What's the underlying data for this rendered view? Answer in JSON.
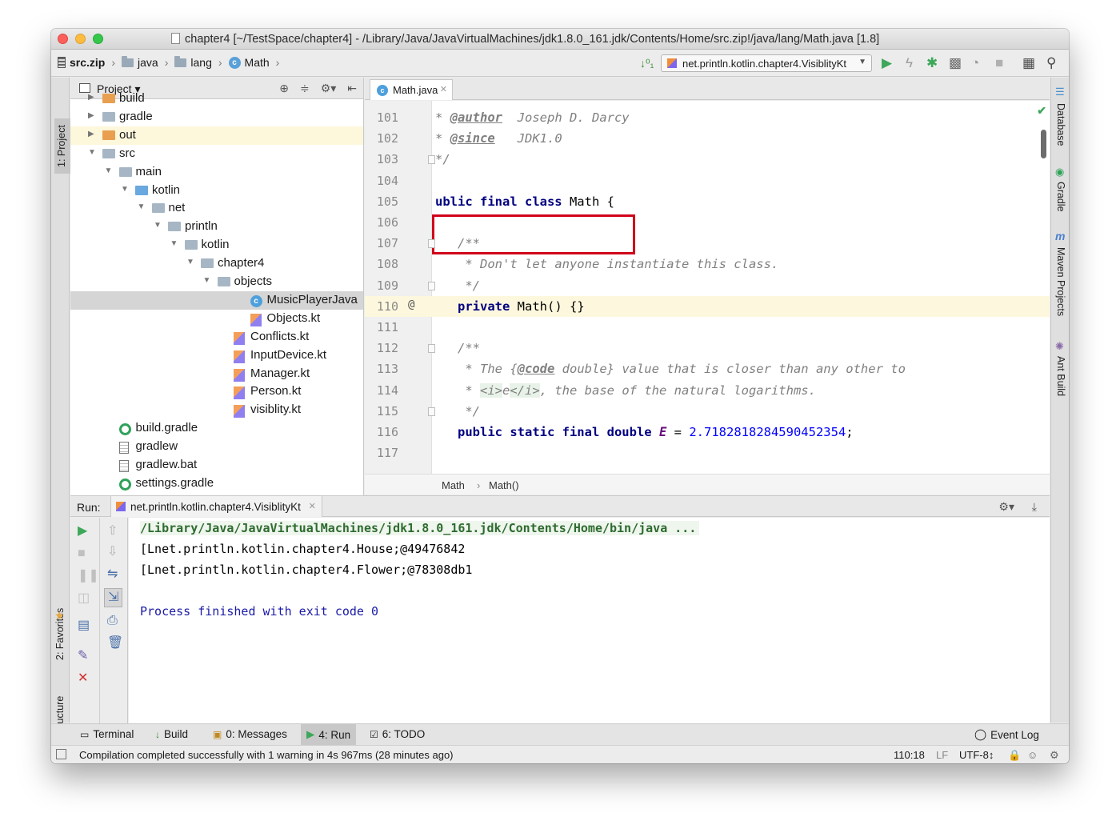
{
  "window": {
    "title": "chapter4 [~/TestSpace/chapter4] - /Library/Java/JavaVirtualMachines/jdk1.8.0_161.jdk/Contents/Home/src.zip!/java/lang/Math.java [1.8]"
  },
  "navbar": {
    "crumbs": [
      "src.zip",
      "java",
      "lang",
      "Math"
    ],
    "run_config": "net.println.kotlin.chapter4.VisiblityKt"
  },
  "left_stripe": {
    "project_tab": "1: Project",
    "favorites_tab": "2: Favorites",
    "structure_tab": "Z: Structure"
  },
  "right_stripe": {
    "database": "Database",
    "gradle": "Gradle",
    "maven": "Maven Projects",
    "ant": "Ant Build"
  },
  "project": {
    "header": "Project",
    "tree": [
      {
        "label": "build",
        "indent": 0,
        "arrow": "right",
        "icon": "folder-orange"
      },
      {
        "label": "gradle",
        "indent": 0,
        "arrow": "right",
        "icon": "folder"
      },
      {
        "label": "out",
        "indent": 0,
        "arrow": "right",
        "icon": "folder-orange",
        "highlight": "orange"
      },
      {
        "label": "src",
        "indent": 0,
        "arrow": "down",
        "icon": "folder"
      },
      {
        "label": "main",
        "indent": 1,
        "arrow": "down",
        "icon": "folder"
      },
      {
        "label": "kotlin",
        "indent": 2,
        "arrow": "down",
        "icon": "folder-blue"
      },
      {
        "label": "net",
        "indent": 3,
        "arrow": "down",
        "icon": "folder"
      },
      {
        "label": "println",
        "indent": 4,
        "arrow": "down",
        "icon": "folder"
      },
      {
        "label": "kotlin",
        "indent": 5,
        "arrow": "down",
        "icon": "folder"
      },
      {
        "label": "chapter4",
        "indent": 6,
        "arrow": "down",
        "icon": "folder"
      },
      {
        "label": "objects",
        "indent": 7,
        "arrow": "down",
        "icon": "folder"
      },
      {
        "label": "MusicPlayerJava",
        "indent": 9,
        "arrow": "",
        "icon": "class",
        "selected": true
      },
      {
        "label": "Objects.kt",
        "indent": 9,
        "arrow": "",
        "icon": "kotlin"
      },
      {
        "label": "Conflicts.kt",
        "indent": 8,
        "arrow": "",
        "icon": "kotlin"
      },
      {
        "label": "InputDevice.kt",
        "indent": 8,
        "arrow": "",
        "icon": "kotlin"
      },
      {
        "label": "Manager.kt",
        "indent": 8,
        "arrow": "",
        "icon": "kotlin"
      },
      {
        "label": "Person.kt",
        "indent": 8,
        "arrow": "",
        "icon": "kotlin"
      },
      {
        "label": "visiblity.kt",
        "indent": 8,
        "arrow": "",
        "icon": "kotlin"
      },
      {
        "label": "build.gradle",
        "indent": 1,
        "arrow": "",
        "icon": "gradle"
      },
      {
        "label": "gradlew",
        "indent": 1,
        "arrow": "",
        "icon": "file"
      },
      {
        "label": "gradlew.bat",
        "indent": 1,
        "arrow": "",
        "icon": "file"
      },
      {
        "label": "settings.gradle",
        "indent": 1,
        "arrow": "",
        "icon": "gradle"
      }
    ]
  },
  "editor": {
    "tab": "Math.java",
    "lines": [
      {
        "n": "101",
        "html": "<span class='cm'>* </span><span class='tag'>@author</span><span class='cm'>  Joseph D. Darcy</span>"
      },
      {
        "n": "102",
        "html": "<span class='cm'>* </span><span class='tag'>@since</span><span class='cm'>   JDK1.0</span>"
      },
      {
        "n": "103",
        "html": "<span class='cm'>*/</span>"
      },
      {
        "n": "104",
        "html": ""
      },
      {
        "n": "105",
        "html": "<span class='kw'>ublic final class</span> Math {"
      },
      {
        "n": "106",
        "html": ""
      },
      {
        "n": "107",
        "html": "   <span class='cm'>/**</span>"
      },
      {
        "n": "108",
        "html": "   <span class='cm'> * Don't let anyone instantiate this class.</span>"
      },
      {
        "n": "109",
        "html": "   <span class='cm'> */</span>"
      },
      {
        "n": "110",
        "html": "   <span class='kw'>private</span> Math() {}"
      },
      {
        "n": "111",
        "html": ""
      },
      {
        "n": "112",
        "html": "   <span class='cm'>/**</span>"
      },
      {
        "n": "113",
        "html": "   <span class='cm'> * The {</span><span class='tag'>@code</span><span class='cm'> double} value that is closer than any other to</span>"
      },
      {
        "n": "114",
        "html": "   <span class='cm'> * </span><span class='htmltag'>&lt;i&gt;</span><span class='cm'>e</span><span class='htmltag'>&lt;/i&gt;</span><span class='cm'>, the base of the natural logarithms.</span>"
      },
      {
        "n": "115",
        "html": "   <span class='cm'> */</span>"
      },
      {
        "n": "116",
        "html": "   <span class='kw'>public static final double</span> <span class='const'>E</span> = <span class='num'>2.7182818284590452354</span>;"
      },
      {
        "n": "117",
        "html": ""
      }
    ],
    "breadcrumb": [
      "Math",
      "Math()"
    ]
  },
  "run": {
    "label": "Run:",
    "tab": "net.println.kotlin.chapter4.VisiblityKt",
    "console": [
      "/Library/Java/JavaVirtualMachines/jdk1.8.0_161.jdk/Contents/Home/bin/java ...",
      "[Lnet.println.kotlin.chapter4.House;@49476842",
      "[Lnet.println.kotlin.chapter4.Flower;@78308db1",
      "",
      "Process finished with exit code 0"
    ]
  },
  "bottom_tools": {
    "terminal": "Terminal",
    "build": "Build",
    "messages": "0: Messages",
    "run": "4: Run",
    "todo": "6: TODO",
    "event_log": "Event Log"
  },
  "status": {
    "message": "Compilation completed successfully with 1 warning in 4s 967ms (28 minutes ago)",
    "position": "110:18",
    "line_sep": "LF",
    "encoding": "UTF-8↕"
  },
  "colors": {
    "highlight_box": "#d0021b",
    "caret_line": "#fdf8dd"
  }
}
